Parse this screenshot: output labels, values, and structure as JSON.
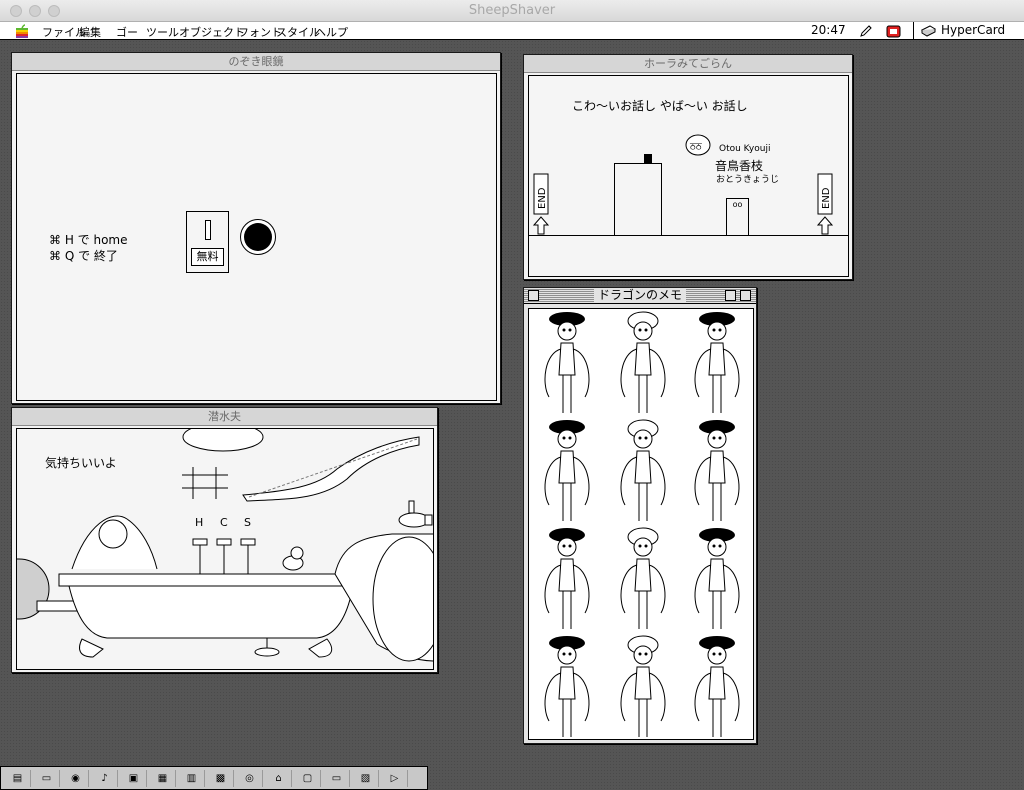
{
  "host": {
    "title": "SheepShaver"
  },
  "menubar": {
    "items": [
      "ファイル",
      "編集",
      "ゴー",
      "ツール",
      "オブジェクト",
      "フォント",
      "スタイル",
      "ヘルプ"
    ],
    "clock": "20:47",
    "app": "HyperCard"
  },
  "windows": {
    "nozoki": {
      "title": "のぞき眼鏡",
      "shortcut_home": "⌘ H で home",
      "shortcut_quit": "⌘ Q で 終了",
      "free_label": "無料"
    },
    "hora": {
      "title": "ホーラみてごらん",
      "headline": "こわ〜いお話し やば〜い お話し",
      "name_romaji": "Otou Kyouji",
      "name_kanji": "音鳥香枝",
      "name_kana": "おとうきょうじ",
      "end_left": "END",
      "end_right": "END"
    },
    "sensui": {
      "title": "潜水夫",
      "message": "気持ちいいよ",
      "tap_h": "H",
      "tap_c": "C",
      "tap_s": "S"
    },
    "dragon": {
      "title": "ドラゴンのメモ"
    }
  },
  "strip": {
    "items": [
      {
        "name": "control-strip-sharing-icon",
        "glyph": "▤"
      },
      {
        "name": "control-strip-monitor-icon",
        "glyph": "▭"
      },
      {
        "name": "control-strip-cd-icon",
        "glyph": "◉"
      },
      {
        "name": "control-strip-sound-icon",
        "glyph": "♪"
      },
      {
        "name": "control-strip-appletalk-icon",
        "glyph": "▣"
      },
      {
        "name": "control-strip-fileshare-icon",
        "glyph": "▦"
      },
      {
        "name": "control-strip-colordepth-icon",
        "glyph": "▥"
      },
      {
        "name": "control-strip-resolution-icon",
        "glyph": "▩"
      },
      {
        "name": "control-strip-disc-icon",
        "glyph": "◎"
      },
      {
        "name": "control-strip-lock-icon",
        "glyph": "⌂"
      },
      {
        "name": "control-strip-disk-icon",
        "glyph": "▢"
      },
      {
        "name": "control-strip-printer-icon",
        "glyph": "▭"
      },
      {
        "name": "control-strip-network-icon",
        "glyph": "▧"
      },
      {
        "name": "control-strip-arrow-icon",
        "glyph": "▷"
      }
    ]
  }
}
